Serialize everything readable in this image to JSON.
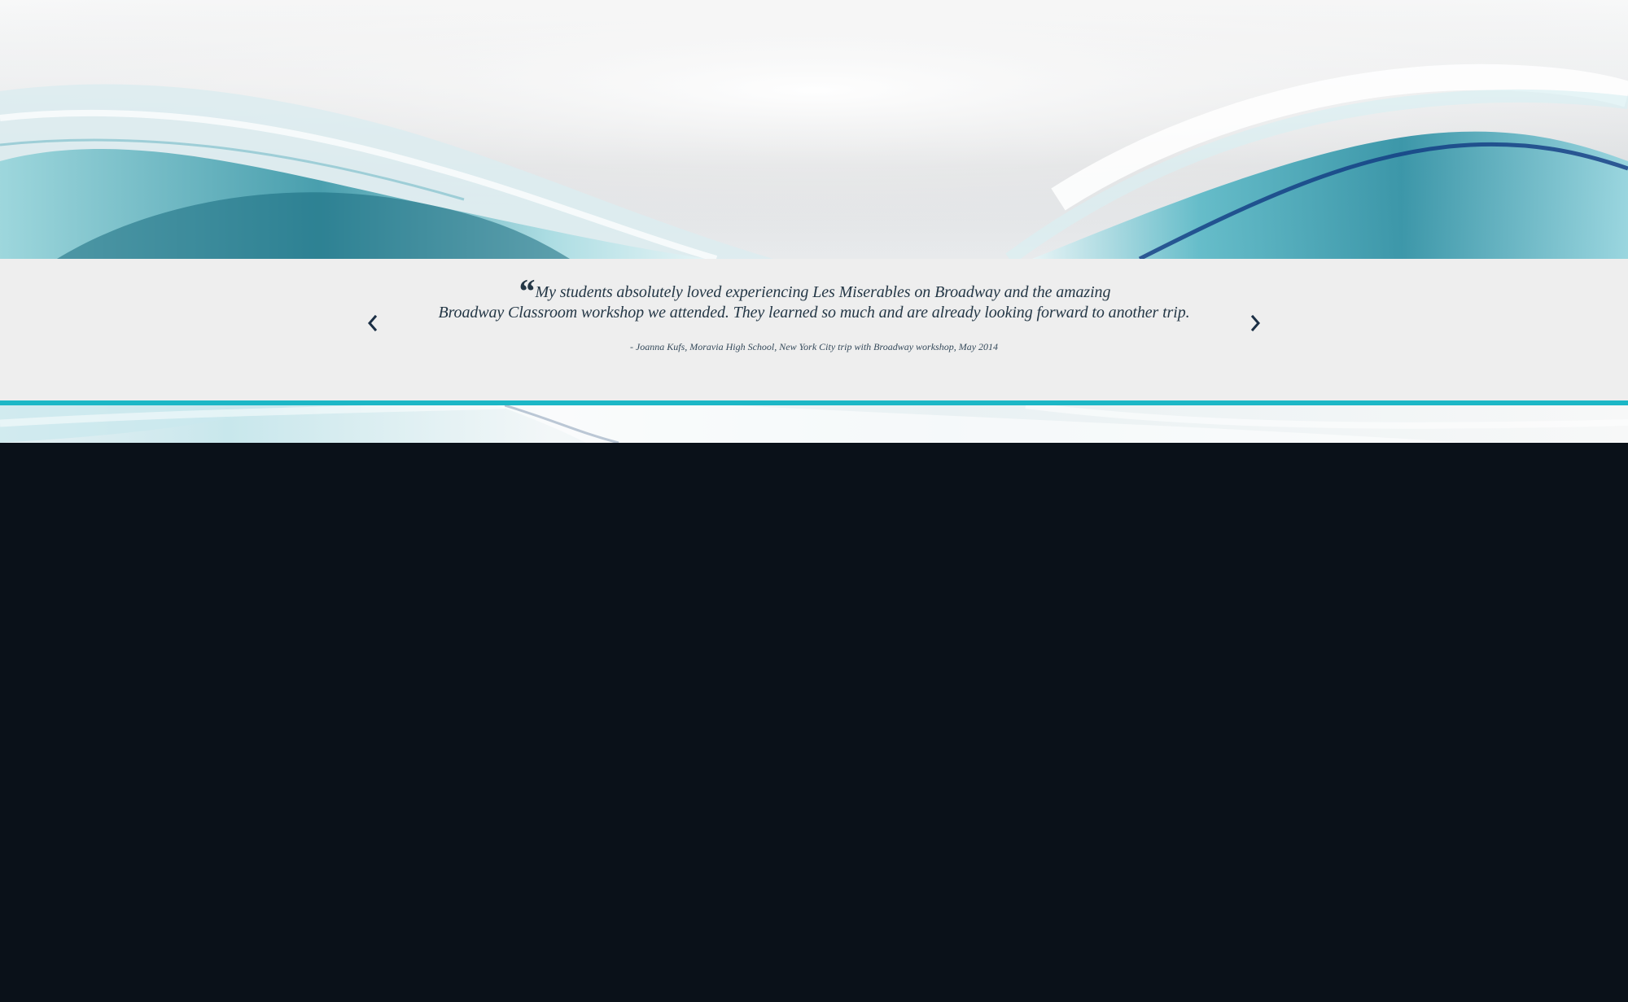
{
  "testimonial": {
    "quote_mark": "“",
    "quote_line_1": "My students absolutely loved experiencing Les Miserables on Broadway and the amazing",
    "quote_line_2": "Broadway Classroom workshop we attended. They learned so much and are already looking forward to another trip.",
    "attribution": "- Joanna Kufs, Moravia High School, New York City trip with Broadway workshop, May 2014"
  },
  "navigation": {
    "previous_icon": "chevron-left-icon",
    "next_icon": "chevron-right-icon"
  },
  "colors": {
    "panel_background": "#eeeeee",
    "accent_line": "#1cb7c6",
    "dark_background": "#0a1119",
    "text": "#243746"
  }
}
